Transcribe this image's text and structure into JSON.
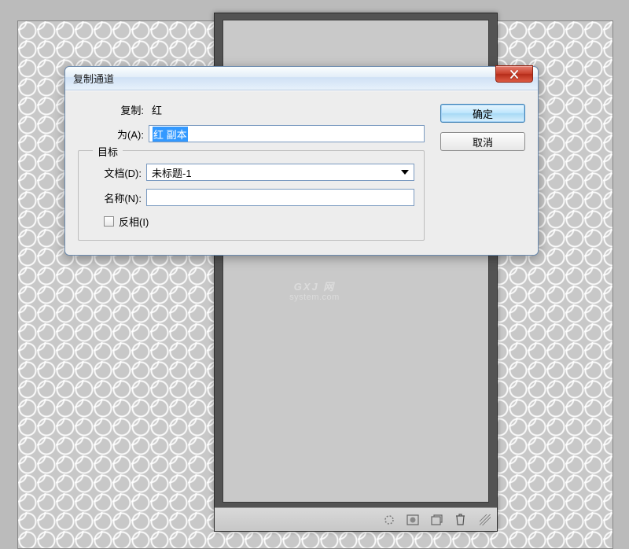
{
  "watermark": {
    "main": "GXJ 网",
    "sub": "system.com"
  },
  "dialog": {
    "title": "复制通道",
    "close_tooltip": "关闭",
    "labels": {
      "copy": "复制:",
      "as": "为(A):",
      "target_legend": "目标",
      "document": "文档(D):",
      "name": "名称(N):",
      "invert": "反相(I)"
    },
    "values": {
      "copy_source": "红",
      "as_value": "红 副本",
      "document_value": "未标题-1",
      "name_value": ""
    },
    "buttons": {
      "ok": "确定",
      "cancel": "取消"
    }
  },
  "toolbar": {
    "icons": [
      "loading-icon",
      "layer-mask-icon",
      "new-channel-icon",
      "trash-icon"
    ]
  }
}
